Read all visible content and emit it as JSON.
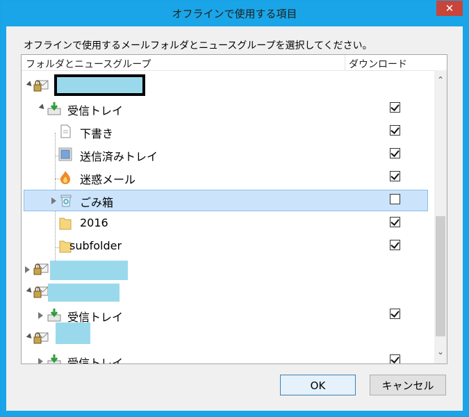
{
  "window": {
    "title": "オフラインで使用する項目",
    "close_glyph": "✕"
  },
  "instruction": "オフラインで使用するメールフォルダとニュースグループを選択してください。",
  "columns": {
    "folders": "フォルダとニュースグループ",
    "download": "ダウンロード"
  },
  "rows": [
    {
      "type": "account",
      "expanded": true,
      "checked": null
    },
    {
      "type": "inbox",
      "label": "受信トレイ",
      "expanded": true,
      "checked": true
    },
    {
      "type": "folder",
      "label": "下書き",
      "icon": "drafts-icon",
      "checked": true
    },
    {
      "type": "folder",
      "label": "送信済みトレイ",
      "icon": "sent-icon",
      "checked": true
    },
    {
      "type": "folder",
      "label": "迷惑メール",
      "icon": "junk-icon",
      "checked": true
    },
    {
      "type": "folder",
      "label": "ごみ箱",
      "icon": "trash-icon",
      "checked": false,
      "selected": true,
      "expanded": false
    },
    {
      "type": "folder",
      "label": "2016",
      "icon": "folder-icon",
      "checked": true
    },
    {
      "type": "folder",
      "label": "subfolder",
      "icon": "folder-icon",
      "checked": true
    },
    {
      "type": "account",
      "expanded": false,
      "checked": null
    },
    {
      "type": "account",
      "expanded": true,
      "checked": null
    },
    {
      "type": "inbox",
      "label": "受信トレイ",
      "expanded": false,
      "checked": true
    },
    {
      "type": "account",
      "expanded": true,
      "checked": null
    },
    {
      "type": "inbox",
      "label": "受信トレイ",
      "expanded": false,
      "checked": true
    }
  ],
  "buttons": {
    "ok": "OK",
    "cancel": "キャンセル"
  },
  "scrollbar": {
    "up_glyph": "⌃",
    "down_glyph": "⌄"
  },
  "colors": {
    "titlebar": "#19a5e8",
    "selection": "#cce4fb",
    "redaction": "#9ad9ec"
  }
}
